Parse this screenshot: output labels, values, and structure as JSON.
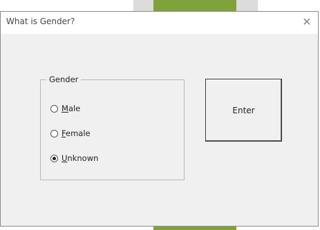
{
  "dialog": {
    "title": "What is Gender?",
    "close_glyph": "✕"
  },
  "frame": {
    "label": "Gender",
    "options": [
      {
        "label": "Male",
        "accel": "M",
        "rest": "ale",
        "selected": false
      },
      {
        "label": "Female",
        "accel": "F",
        "rest": "emale",
        "selected": false
      },
      {
        "label": "Unknown",
        "accel": "U",
        "rest": "nknown",
        "selected": true
      }
    ]
  },
  "enter_button": {
    "label": "Enter"
  },
  "colors": {
    "dialog_bg": "#f0f0f0",
    "titlebar_bg": "#ffffff",
    "background_green": "#7fa33a"
  }
}
